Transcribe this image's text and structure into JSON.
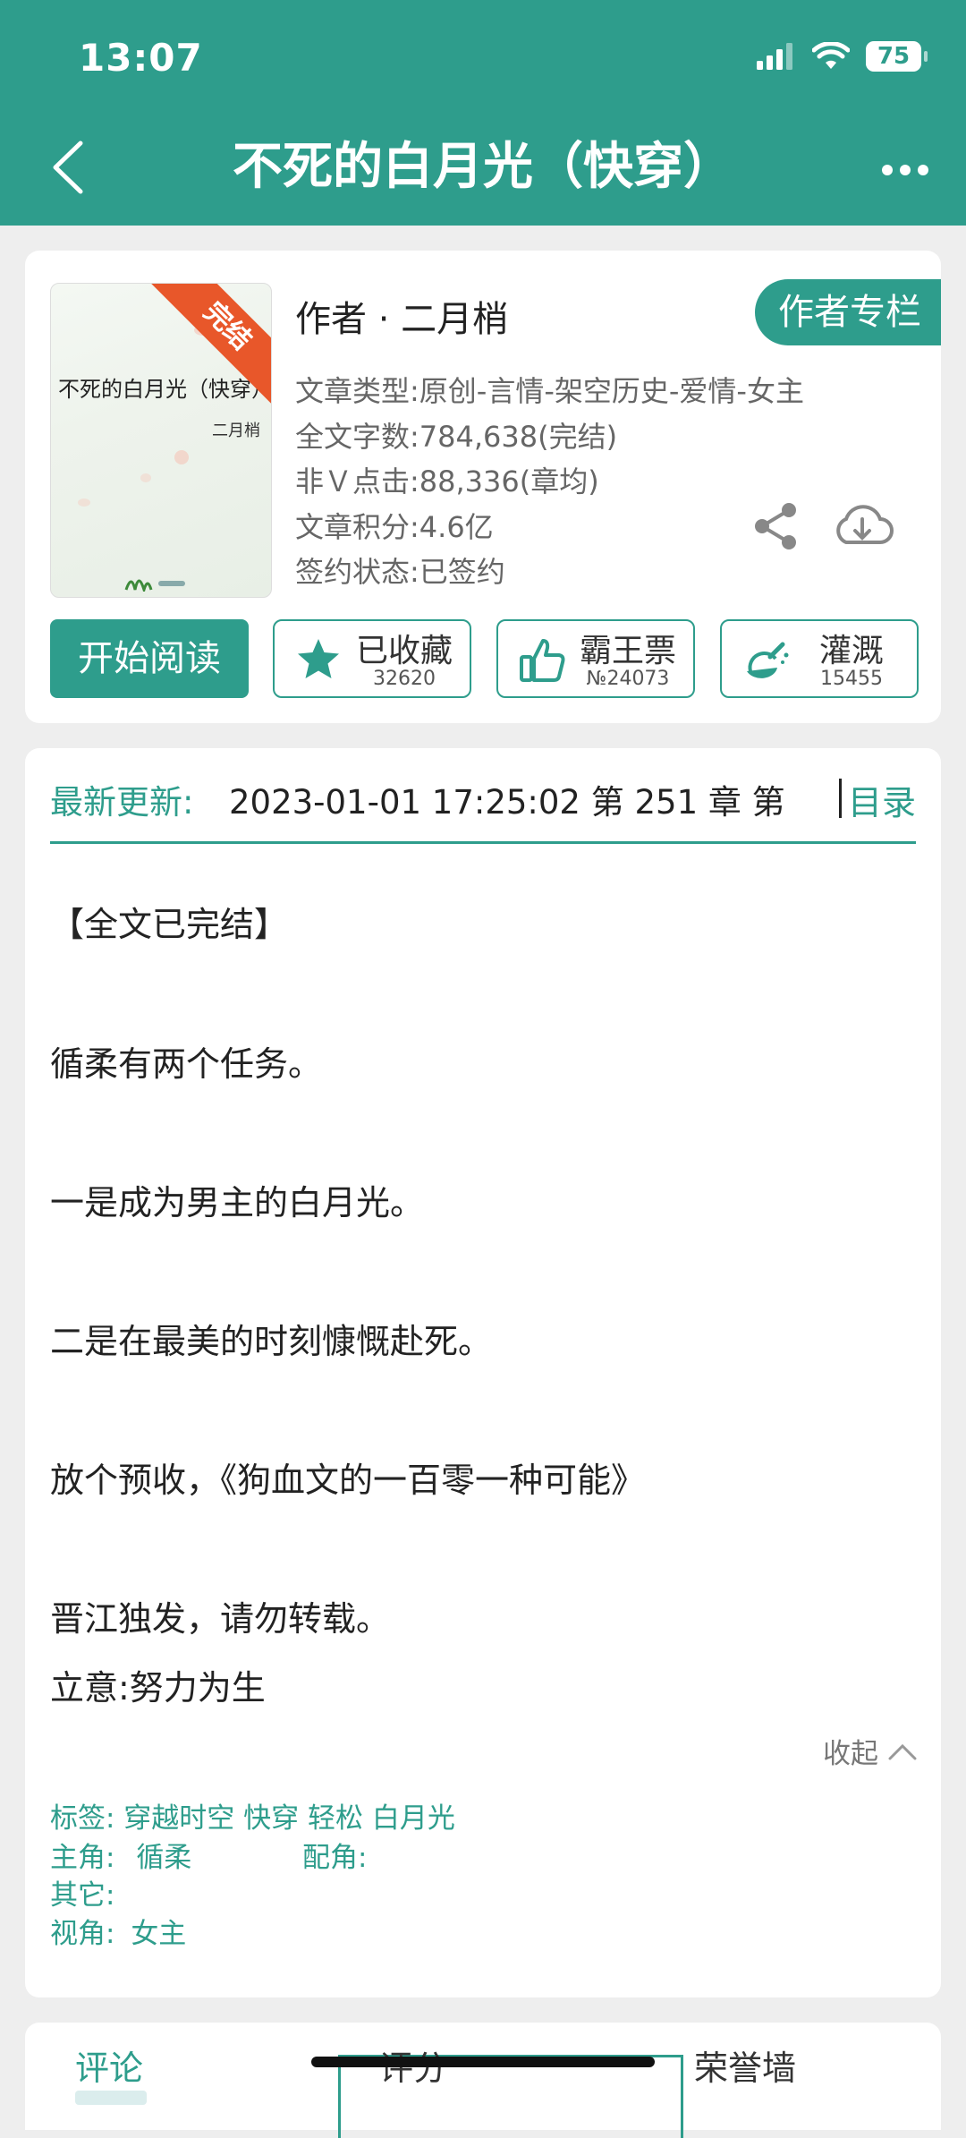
{
  "status": {
    "time": "13:07",
    "battery": "75"
  },
  "nav": {
    "title": "不死的白月光（快穿）"
  },
  "book": {
    "cover_title": "不死的白月光（快穿）",
    "cover_author": "二月梢",
    "ribbon": "完结",
    "author_line": "作者 · 二月梢",
    "author_column_button": "作者专栏",
    "meta": [
      "文章类型:原创-言情-架空历史-爱情-女主",
      "全文字数:784,638(完结)",
      "非Ｖ点击:88,336(章均)",
      "文章积分:4.6亿",
      "签约状态:已签约"
    ]
  },
  "actions": {
    "read": "开始阅读",
    "favorite": {
      "label": "已收藏",
      "count": "32620"
    },
    "bawang": {
      "label": "霸王票",
      "count": "№24073"
    },
    "irrigate": {
      "label": "灌溉",
      "count": "15455"
    }
  },
  "update": {
    "label": "最新更新:",
    "text": "2023-01-01 17:25:02   第 251 章  第",
    "toc": "目录"
  },
  "description": [
    "【全文已完结】",
    "循柔有两个任务。",
    "一是成为男主的白月光。",
    "二是在最美的时刻慷慨赴死。",
    "放个预收，《狗血文的一百零一种可能》",
    "晋江独发，请勿转载。",
    "立意:努力为生"
  ],
  "collapse": "收起",
  "tags": {
    "tags_line": "标签:   穿越时空   快穿   轻松    白月光",
    "protagonist_label": "主角:",
    "protagonist": "循柔",
    "supporting_label": "配角:",
    "other_label": "其它:",
    "perspective_label": "视角:",
    "perspective": "女主"
  },
  "bottom_tabs": {
    "comments": "评论",
    "rating": "评分",
    "honor": "荣誉墙"
  },
  "colors": {
    "accent": "#2e9d8c",
    "ribbon": "#e8572a"
  }
}
